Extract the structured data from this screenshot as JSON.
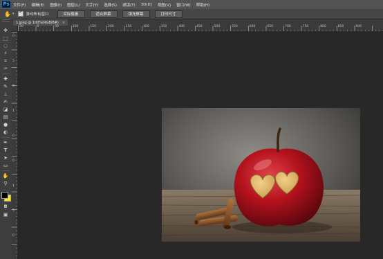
{
  "app": {
    "logo": "Ps"
  },
  "menu": [
    "文件(F)",
    "编辑(E)",
    "图像(I)",
    "图层(L)",
    "文字(Y)",
    "选择(S)",
    "滤镜(T)",
    "3D(D)",
    "视图(V)",
    "窗口(W)",
    "帮助(H)"
  ],
  "options": {
    "tool_icon": "hand-icon",
    "scroll_all_windows": {
      "checked": true,
      "label": "滚动所有窗口"
    },
    "buttons": [
      "实际像素",
      "适合屏幕",
      "填充屏幕",
      "打印尺寸"
    ]
  },
  "document": {
    "tab_title": "1.jpeg @ 100%(RGB/8#)",
    "close_glyph": "×"
  },
  "rulers": {
    "top_labels": [
      "50",
      "0",
      "50",
      "100",
      "150",
      "200",
      "250",
      "300",
      "350",
      "400",
      "450",
      "500",
      "550",
      "600",
      "650",
      "700",
      "750",
      "800",
      "850",
      "900"
    ],
    "left_labels": [
      "0",
      "5",
      "0",
      "1",
      "0",
      "0",
      "1",
      "5",
      "0"
    ]
  },
  "tools": [
    "move-icon",
    "marquee-icon",
    "lasso-icon",
    "quick-select-icon",
    "crop-icon",
    "eyedropper-icon",
    "healing-brush-icon",
    "brush-icon",
    "clone-stamp-icon",
    "history-brush-icon",
    "eraser-icon",
    "gradient-icon",
    "blur-icon",
    "dodge-icon",
    "pen-icon",
    "type-icon",
    "path-select-icon",
    "rectangle-icon",
    "hand-icon",
    "zoom-icon"
  ],
  "colors": {
    "foreground": "#000000",
    "background": "#ffe600",
    "accent": "#31a8ff"
  },
  "canvas": {
    "image_subject": "red apple with two carved hearts and cinnamon sticks on a wooden table"
  }
}
